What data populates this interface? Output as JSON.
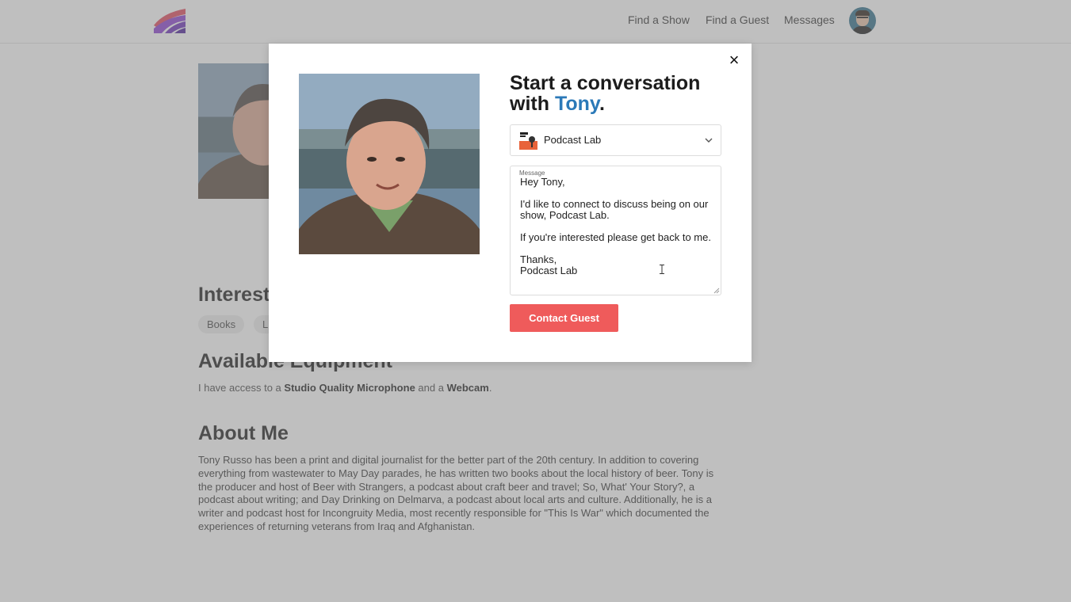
{
  "nav": {
    "find_show": "Find a Show",
    "find_guest": "Find a Guest",
    "messages": "Messages"
  },
  "sections": {
    "interests": "Interests",
    "equipment": "Available Equipment",
    "about": "About Me"
  },
  "interests": [
    "Books",
    "Li"
  ],
  "equipment": {
    "prefix": "I have access to a",
    "item1": "Studio Quality Microphone",
    "joiner": "and a",
    "item2": "Webcam",
    "suffix": "."
  },
  "about_text": "Tony Russo has been a print and digital journalist for the better part of the 20th century. In addition to covering everything from wastewater to May Day parades, he has written two books about the local history of beer. Tony is the producer and host of Beer with Strangers, a podcast about craft beer and travel; So, What' Your Story?, a podcast about writing; and Day Drinking on Delmarva, a podcast about local arts and culture. Additionally, he is a writer and podcast host for Incongruity Media, most recently responsible for \"This Is War\" which documented the experiences of returning veterans from Iraq and Afghanistan.",
  "modal": {
    "heading_prefix": "Start a conversation with",
    "guest_name": "Tony",
    "heading_suffix": ".",
    "selected_show": "Podcast Lab",
    "message_label": "Message",
    "message_text": "Hey Tony,\n\nI'd like to connect to discuss being on our show, Podcast Lab.\n\nIf you're interested please get back to me.\n\nThanks,\nPodcast Lab",
    "contact_button": "Contact Guest",
    "close_glyph": "×"
  },
  "icons": {
    "logo": "brand-logo-icon",
    "close": "close-icon",
    "chevron": "chevron-down-icon",
    "show_thumb": "podcast-lab-thumbnail"
  },
  "colors": {
    "accent_button": "#ef5b5b",
    "name_link": "#2b79b8",
    "overlay": "rgba(128,128,128,0.5)"
  }
}
